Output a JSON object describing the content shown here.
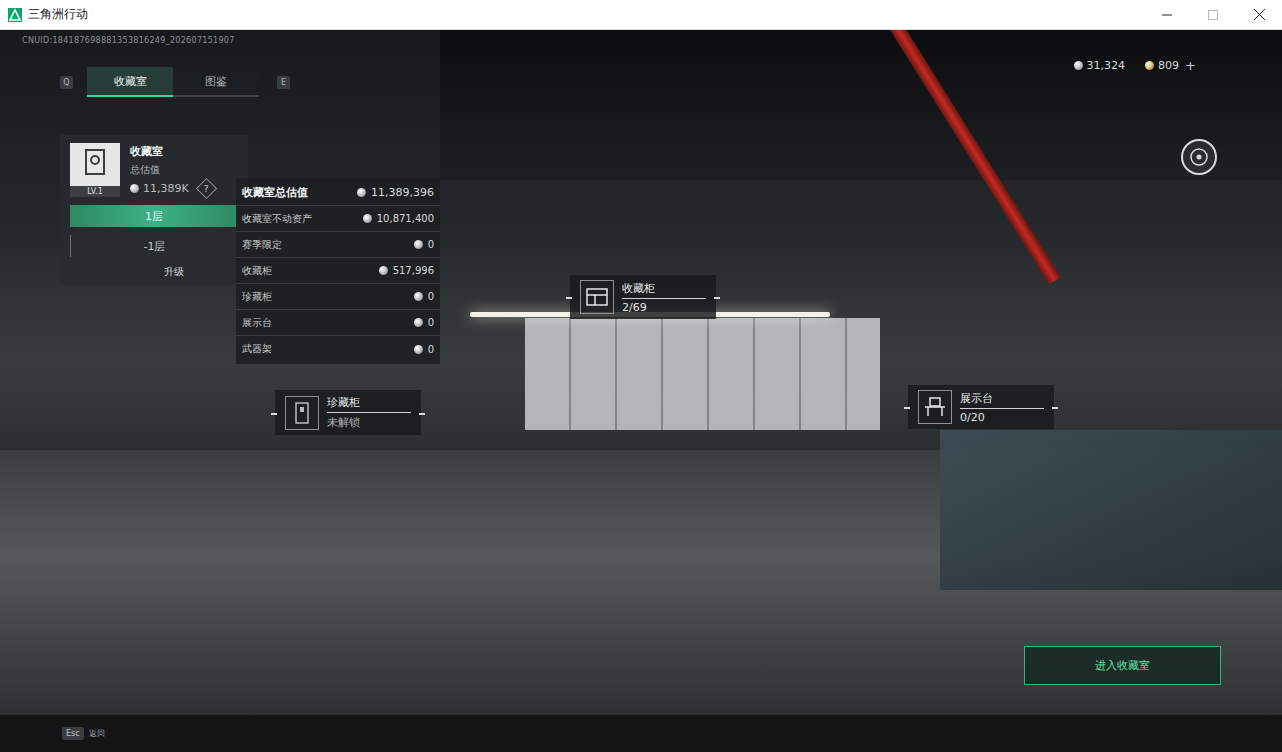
{
  "window": {
    "title": "三角洲行动"
  },
  "uid": "CNUID:184187698881353816249_202607151907",
  "tabs": {
    "prev_key": "Q",
    "next_key": "E",
    "items": [
      {
        "label": "收藏室",
        "selected": true
      },
      {
        "label": "图鉴",
        "selected": false
      }
    ]
  },
  "currency": [
    {
      "amount": "31,324",
      "color": "#b9bcbf"
    },
    {
      "amount": "809",
      "color": "#d8b35a"
    }
  ],
  "currency_add": "+",
  "collection": {
    "title": "收藏室",
    "subtitle": "总估值",
    "value": "11,389K",
    "help": "?",
    "level": "LV.1",
    "floors": [
      {
        "label": "1层",
        "selected": true
      },
      {
        "label": "-1层",
        "selected": false
      }
    ],
    "upgrade": "升级"
  },
  "tooltip": {
    "rows": [
      {
        "label": "收藏室总估值",
        "value": "11,389,396",
        "kind": "header"
      },
      {
        "label": "收藏室不动资产",
        "value": "10,871,400",
        "kind": "item"
      },
      {
        "label": "赛季限定",
        "value": "0",
        "kind": "item"
      },
      {
        "label": "收藏柜",
        "value": "517,996",
        "kind": "item"
      },
      {
        "label": "珍藏柜",
        "value": "0",
        "kind": "item"
      },
      {
        "label": "展示台",
        "value": "0",
        "kind": "item"
      },
      {
        "label": "武器架",
        "value": "0",
        "kind": "item"
      }
    ]
  },
  "markers": [
    {
      "name": "收藏柜",
      "status": "2/69",
      "locked": false
    },
    {
      "name": "珍藏柜",
      "status": "未解锁",
      "locked": true
    },
    {
      "name": "展示台",
      "status": "0/20",
      "locked": false
    }
  ],
  "enter_button": "进入收藏室",
  "footer": {
    "key": "Esc",
    "label": "返回"
  }
}
